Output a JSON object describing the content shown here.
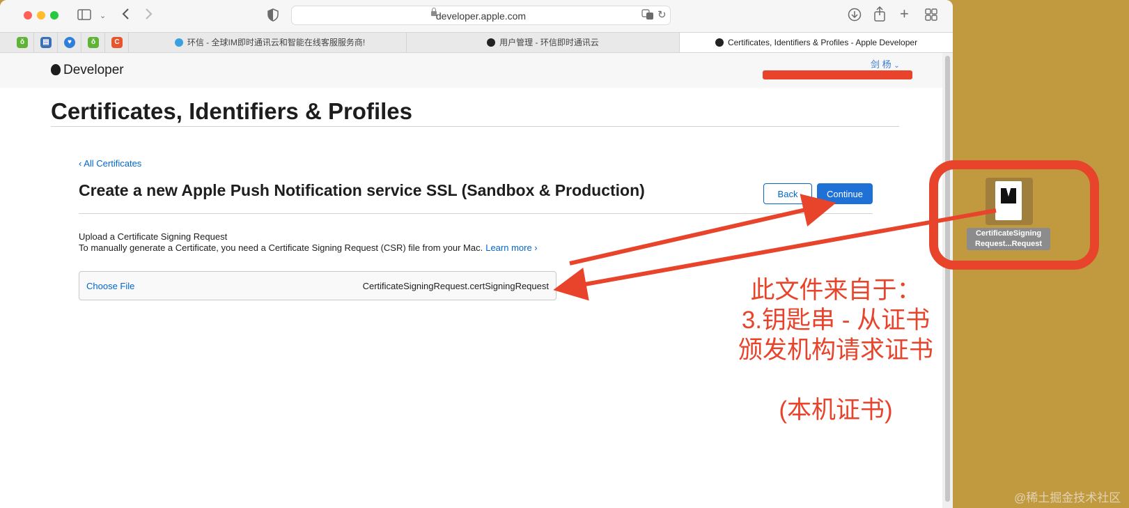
{
  "browser": {
    "url": "developer.apple.com",
    "pinned_tabs": [
      {
        "icon": "leaf-icon",
        "color": "#5fb336"
      },
      {
        "icon": "folder-icon",
        "color": "#3d6fb6"
      },
      {
        "icon": "shield-icon",
        "color": "#2f7fd9"
      },
      {
        "icon": "leaf-icon",
        "color": "#5fb336"
      },
      {
        "icon": "c-icon",
        "color": "#e8542c"
      }
    ],
    "tabs": [
      {
        "label": "环信 - 全球IM即时通讯云和智能在线客服服务商!"
      },
      {
        "label": "用户管理 - 环信即时通讯云"
      },
      {
        "label": "Certificates, Identifiers & Profiles - Apple Developer"
      }
    ]
  },
  "header": {
    "logo_text": "Developer",
    "account_name": "剑 杨"
  },
  "page": {
    "title": "Certificates, Identifiers & Profiles",
    "back_link": "‹ All Certificates",
    "section_title": "Create a new Apple Push Notification service SSL (Sandbox & Production)",
    "back_button": "Back",
    "continue_button": "Continue",
    "upload_title": "Upload a Certificate Signing Request",
    "upload_desc": "To manually generate a Certificate, you need a Certificate Signing Request (CSR) file from your Mac.",
    "learn_more": "Learn more ›",
    "choose_file": "Choose File",
    "file_name": "CertificateSigningRequest.certSigningRequest"
  },
  "desktop": {
    "file_icon_label_line1": "CertificateSigning",
    "file_icon_label_line2": "Request...Request"
  },
  "annotation": {
    "lines": [
      "此文件来自于：",
      "3.钥匙串 - 从证书",
      "颁发机构请求证书"
    ],
    "note": "(本机证书)",
    "color": "#e8432b"
  },
  "watermark": "@稀土掘金技术社区",
  "colors": {
    "accent": "#0066cc",
    "continue_bg": "#1f71d6",
    "desktop": "#c1993f"
  }
}
